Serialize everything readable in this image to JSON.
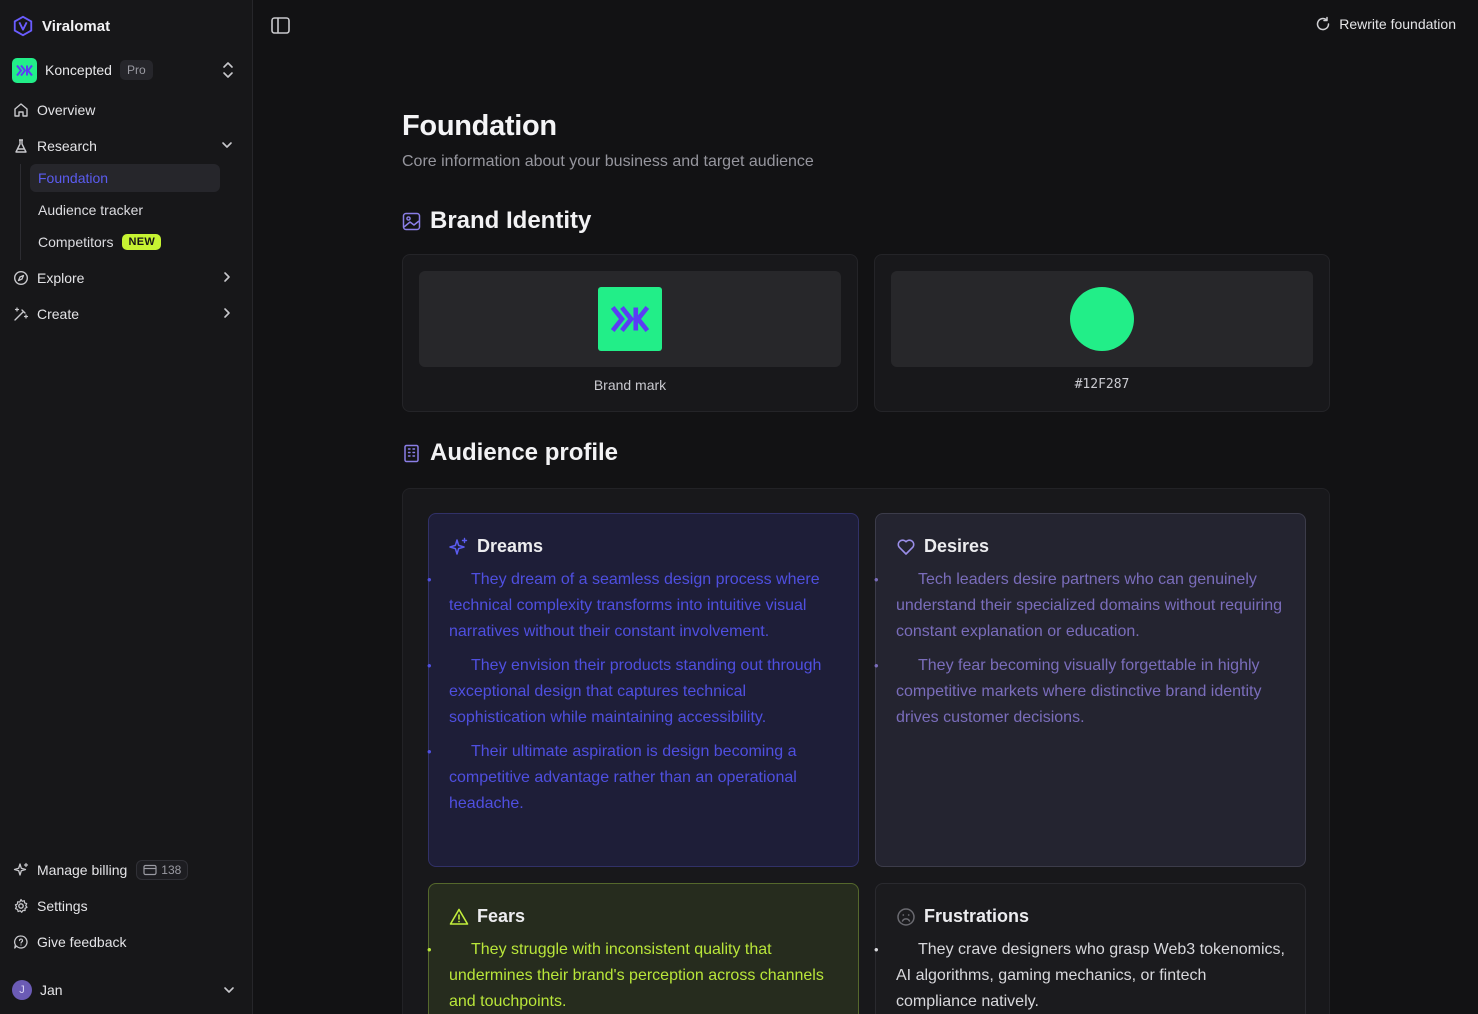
{
  "app": {
    "name": "Viralomat"
  },
  "workspace": {
    "name": "Koncepted",
    "plan": "Pro"
  },
  "nav": {
    "overview": "Overview",
    "research": "Research",
    "research_items": [
      {
        "label": "Foundation",
        "active": true
      },
      {
        "label": "Audience tracker"
      },
      {
        "label": "Competitors",
        "badge": "NEW"
      }
    ],
    "explore": "Explore",
    "create": "Create"
  },
  "footer": {
    "billing": "Manage billing",
    "credits": "138",
    "settings": "Settings",
    "feedback": "Give feedback",
    "user": {
      "initial": "J",
      "name": "Jan"
    }
  },
  "header": {
    "rewrite_label": "Rewrite foundation"
  },
  "page": {
    "title": "Foundation",
    "subtitle": "Core information about your business and target audience"
  },
  "brand_identity": {
    "title": "Brand Identity",
    "mark_label": "Brand mark",
    "color_hex": "#12F287"
  },
  "audience": {
    "title": "Audience profile",
    "dreams": {
      "title": "Dreams",
      "items": [
        "They dream of a seamless design process where technical complexity transforms into intuitive visual narratives without their constant involvement.",
        "They envision their products standing out through exceptional design that captures technical sophistication while maintaining accessibility.",
        "Their ultimate aspiration is design becoming a competitive advantage rather than an operational headache."
      ]
    },
    "desires": {
      "title": "Desires",
      "items": [
        "Tech leaders desire partners who can genuinely understand their specialized domains without requiring constant explanation or education.",
        "They fear becoming visually forgettable in highly competitive markets where distinctive brand identity drives customer decisions."
      ]
    },
    "fears": {
      "title": "Fears",
      "items": [
        "They struggle with inconsistent quality that undermines their brand's perception across channels and touchpoints."
      ]
    },
    "frustrations": {
      "title": "Frustrations",
      "items": [
        "They crave designers who grasp Web3 tokenomics, AI algorithms, gaming mechanics, or fintech compliance natively."
      ]
    }
  },
  "colors": {
    "accent": "#5B5CF0",
    "brand_green": "#22EE88",
    "badge_lime": "#C6F432"
  },
  "icons": {
    "brand": "viralomat-logo-icon",
    "home": "home-icon",
    "research": "flask-icon",
    "explore": "compass-icon",
    "create": "magic-wand-icon",
    "billing": "sparkles-icon",
    "settings": "gear-icon",
    "feedback": "chat-bubble-icon",
    "rewrite": "refresh-icon",
    "brand_identity": "image-icon",
    "audience": "building-icon",
    "dreams": "sparkles-icon",
    "desires": "heart-icon",
    "fears": "warning-icon",
    "frustrations": "frown-icon"
  }
}
